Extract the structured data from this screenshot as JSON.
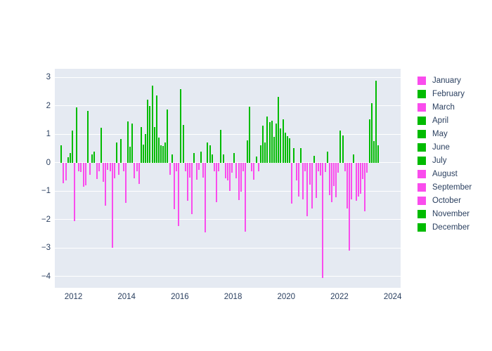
{
  "chart_data": {
    "type": "bar",
    "title": "",
    "subtitle": "",
    "xlabel": "",
    "ylabel": "",
    "xlim": [
      2011.3,
      2024.3
    ],
    "ylim": [
      -4.4,
      3.3
    ],
    "xticks": [
      2012,
      2014,
      2016,
      2018,
      2020,
      2022,
      2024
    ],
    "yticks": [
      -4,
      -3,
      -2,
      -1,
      0,
      1,
      2,
      3
    ],
    "grid": true,
    "legend_position": "right",
    "colors": {
      "positive": "#00bb00",
      "negative": "#fa4ced",
      "plot_background": "#e5eaf2",
      "paper_background": "#ffffff",
      "gridline": "#ffffff",
      "tick_text": "#2a3f5f"
    },
    "legend": [
      {
        "label": "January",
        "color": "#fa4ced"
      },
      {
        "label": "February",
        "color": "#00bb00"
      },
      {
        "label": "March",
        "color": "#fa4ced"
      },
      {
        "label": "April",
        "color": "#00bb00"
      },
      {
        "label": "May",
        "color": "#00bb00"
      },
      {
        "label": "June",
        "color": "#00bb00"
      },
      {
        "label": "July",
        "color": "#00bb00"
      },
      {
        "label": "August",
        "color": "#fa4ced"
      },
      {
        "label": "September",
        "color": "#fa4ced"
      },
      {
        "label": "October",
        "color": "#fa4ced"
      },
      {
        "label": "November",
        "color": "#00bb00"
      },
      {
        "label": "December",
        "color": "#00bb00"
      }
    ],
    "x": [
      2011.54,
      2011.62,
      2011.71,
      2011.79,
      2011.88,
      2011.96,
      2012.04,
      2012.13,
      2012.21,
      2012.29,
      2012.38,
      2012.46,
      2012.54,
      2012.63,
      2012.71,
      2012.79,
      2012.88,
      2012.96,
      2013.04,
      2013.13,
      2013.21,
      2013.29,
      2013.38,
      2013.46,
      2013.54,
      2013.63,
      2013.71,
      2013.79,
      2013.88,
      2013.96,
      2014.04,
      2014.13,
      2014.21,
      2014.29,
      2014.38,
      2014.46,
      2014.54,
      2014.63,
      2014.71,
      2014.79,
      2014.88,
      2014.96,
      2015.04,
      2015.13,
      2015.21,
      2015.29,
      2015.38,
      2015.46,
      2015.54,
      2015.63,
      2015.71,
      2015.79,
      2015.88,
      2015.96,
      2016.04,
      2016.13,
      2016.21,
      2016.29,
      2016.38,
      2016.46,
      2016.54,
      2016.63,
      2016.71,
      2016.79,
      2016.88,
      2016.96,
      2017.04,
      2017.13,
      2017.21,
      2017.29,
      2017.38,
      2017.46,
      2017.54,
      2017.63,
      2017.71,
      2017.79,
      2017.88,
      2017.96,
      2018.04,
      2018.13,
      2018.21,
      2018.29,
      2018.38,
      2018.46,
      2018.54,
      2018.63,
      2018.71,
      2018.79,
      2018.88,
      2018.96,
      2019.04,
      2019.13,
      2019.21,
      2019.29,
      2019.38,
      2019.46,
      2019.54,
      2019.63,
      2019.71,
      2019.79,
      2019.88,
      2019.96,
      2020.04,
      2020.13,
      2020.21,
      2020.29,
      2020.38,
      2020.46,
      2020.54,
      2020.63,
      2020.71,
      2020.79,
      2020.88,
      2020.96,
      2021.04,
      2021.13,
      2021.21,
      2021.29,
      2021.38,
      2021.46,
      2021.54,
      2021.63,
      2021.71,
      2021.79,
      2021.88,
      2021.96,
      2022.04,
      2022.13,
      2022.21,
      2022.29,
      2022.38,
      2022.46,
      2022.54,
      2022.63,
      2022.71,
      2022.79,
      2022.88,
      2022.96,
      2023.04,
      2023.13,
      2023.21,
      2023.29,
      2023.38,
      2023.46
    ],
    "values": [
      0.62,
      -0.72,
      -0.62,
      0.18,
      0.35,
      1.12,
      -2.06,
      1.94,
      -0.3,
      -0.33,
      -0.85,
      -0.8,
      1.81,
      -0.42,
      0.3,
      0.4,
      -0.58,
      -0.3,
      1.23,
      -0.68,
      -1.52,
      -0.26,
      -0.3,
      -3.0,
      -0.55,
      0.7,
      -0.43,
      0.83,
      -0.3,
      -1.42,
      1.45,
      0.55,
      1.37,
      -0.55,
      -0.3,
      -0.75,
      1.25,
      0.63,
      1.0,
      2.21,
      2.0,
      2.72,
      1.25,
      2.35,
      0.88,
      0.6,
      0.58,
      0.72,
      1.88,
      -0.42,
      0.3,
      -1.63,
      -0.3,
      -2.22,
      2.58,
      1.33,
      -0.3,
      -1.35,
      -0.52,
      -1.8,
      0.35,
      -0.6,
      -0.25,
      0.4,
      -0.52,
      -2.45,
      0.72,
      0.6,
      0.3,
      -0.3,
      -1.38,
      -0.3,
      1.15,
      0.3,
      -0.55,
      -0.62,
      -1.0,
      -0.35,
      0.35,
      -0.55,
      -1.32,
      -1.02,
      -0.3,
      -2.42,
      0.78,
      1.97,
      -0.3,
      -0.6,
      0.22,
      -0.3,
      0.62,
      1.3,
      0.72,
      1.62,
      1.42,
      1.48,
      0.9,
      1.38,
      2.32,
      1.2,
      1.52,
      1.05,
      0.92,
      0.85,
      -1.45,
      0.52,
      -0.62,
      -1.18,
      0.5,
      -1.28,
      -0.3,
      -1.88,
      -0.78,
      -1.6,
      0.25,
      -1.25,
      -0.3,
      -0.45,
      -4.05,
      -0.33,
      0.4,
      -1.15,
      -1.4,
      -0.82,
      -1.22,
      -0.35,
      1.12,
      0.95,
      -0.3,
      -1.62,
      -3.1,
      -1.3,
      0.28,
      -1.33,
      -1.2,
      -1.1,
      -0.58,
      -1.72,
      -0.35,
      1.52,
      2.1,
      0.75,
      2.88,
      0.62
    ]
  }
}
